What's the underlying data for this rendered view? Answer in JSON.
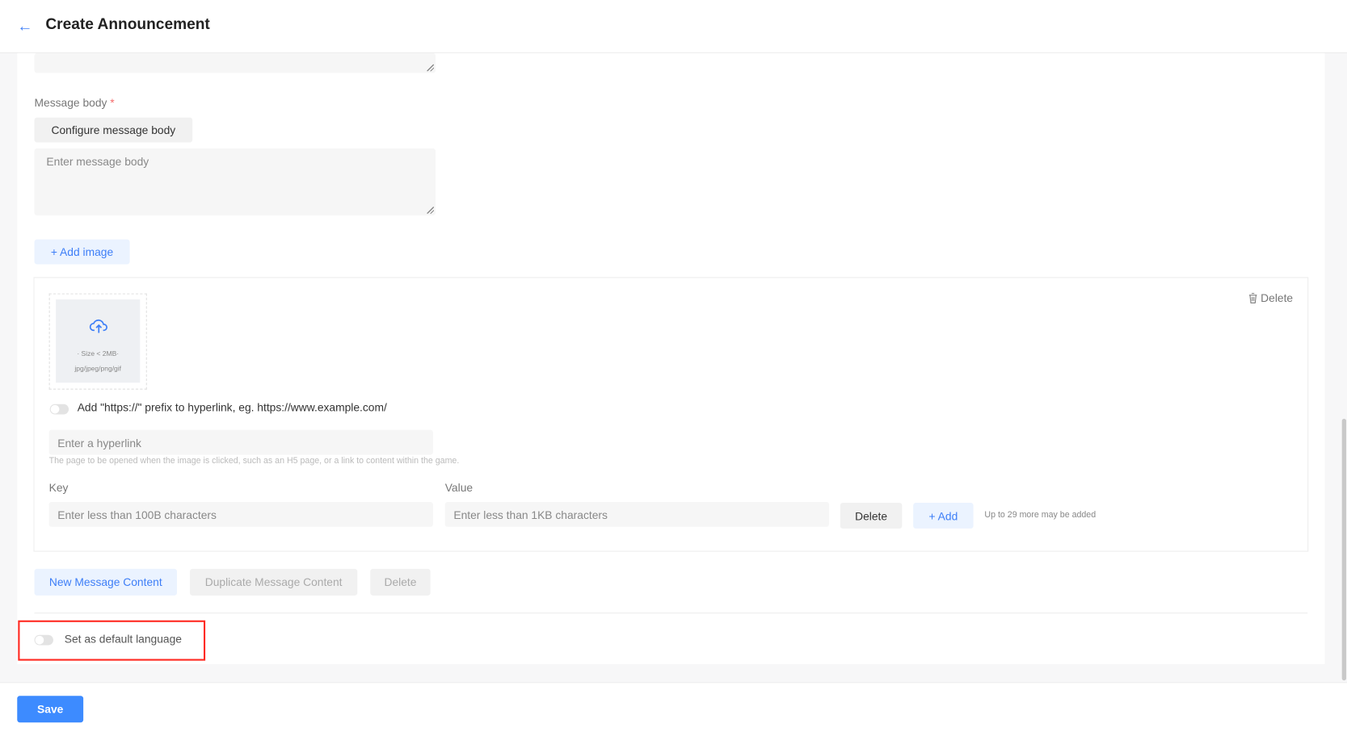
{
  "header": {
    "title": "Create Announcement"
  },
  "message_body": {
    "label": "Message body",
    "required_mark": "*",
    "configure_label": "Configure message body",
    "placeholder": "Enter message body"
  },
  "add_image_label": "+ Add image",
  "image_block": {
    "delete_label": "Delete",
    "upload": {
      "size_hint": "· Size < 2MB·",
      "format_hint": "jpg/jpeg/png/gif"
    },
    "prefix_toggle": {
      "label": "Add \"https://\" prefix to hyperlink, eg. https://www.example.com/",
      "on": false
    },
    "hyperlink": {
      "placeholder": "Enter a hyperlink",
      "hint": "The page to be opened when the image is clicked, such as an H5 page, or a link to content within the game."
    },
    "key": {
      "label": "Key",
      "placeholder": "Enter less than 100B characters"
    },
    "value": {
      "label": "Value",
      "placeholder": "Enter less than 1KB characters"
    },
    "row_delete_label": "Delete",
    "row_add_label": "+ Add",
    "limit_hint": "Up to 29 more may be added"
  },
  "actions": {
    "new_label": "New Message Content",
    "duplicate_label": "Duplicate Message Content",
    "delete_label": "Delete"
  },
  "default_language": {
    "label": "Set as default language",
    "on": false
  },
  "footer": {
    "save_label": "Save"
  },
  "colors": {
    "accent": "#3d7ef7",
    "highlight": "#ff2a22"
  }
}
